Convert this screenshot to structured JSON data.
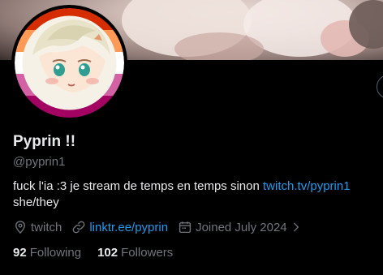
{
  "profile": {
    "name": "Pyprin !!",
    "handle": "@pyprin1",
    "bio_text": "fuck l'ia :3 je stream de temps en temps sinon ",
    "bio_link": "twitch.tv/pyprin1",
    "bio_line2": "she/they",
    "location": "twitch",
    "website": "linktr.ee/pyprin",
    "joined": "Joined July 2024",
    "following_count": "92",
    "following_label": "Following",
    "followers_count": "102",
    "followers_label": "Followers"
  },
  "icons": {
    "location": "location-pin-icon",
    "website": "link-icon",
    "joined": "calendar-icon",
    "chevron": "chevron-right-icon"
  },
  "colors": {
    "background": "#000000",
    "primary_text": "#e7e9ea",
    "secondary_text": "#71767b",
    "link": "#1d9bf0",
    "avatar_ring": [
      "#d52d00",
      "#ff9a56",
      "#ffffff",
      "#d362a4",
      "#a30262"
    ]
  }
}
